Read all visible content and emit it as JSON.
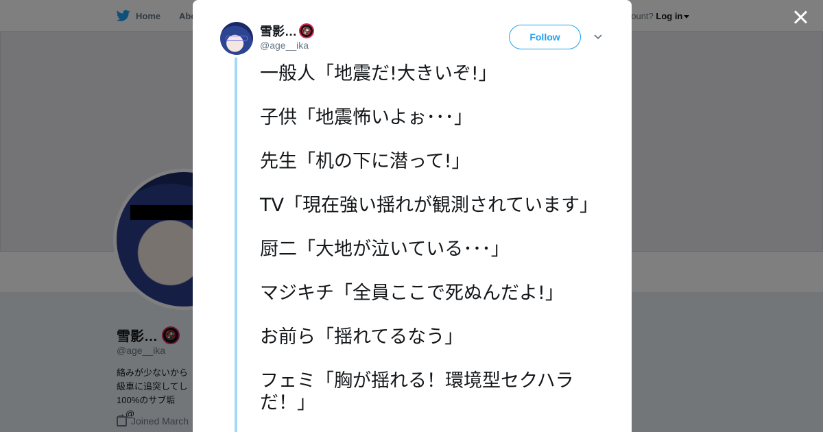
{
  "nav": {
    "home": "Home",
    "about": "Abo",
    "account_prompt": "account?",
    "login": "Log in"
  },
  "profile": {
    "name": "雪影…",
    "handle": "@age__ika",
    "bio": "絡みが少ないから級車に追突してし100%のサブ垢→@",
    "joined": "Joined March"
  },
  "modal": {
    "name": "雪影…",
    "handle": "@age__ika",
    "follow_label": "Follow",
    "badge_glyph": "🚱",
    "tweet_lines": [
      "一般人「地震だ!大きいぞ!」",
      "子供「地震怖いよぉ･･･」",
      "先生「机の下に潜って!」",
      "TV「現在強い揺れが観測されています」",
      "厨二「大地が泣いている･･･」",
      "マジキチ「全員ここで死ぬんだよ!」",
      "お前ら「揺れてるなう」",
      "フェミ「胸が揺れる！環境型セクハラだ！」"
    ]
  },
  "icons": {
    "logo": "twitter-bird-icon",
    "close": "close-icon",
    "more": "chevron-down-icon",
    "calendar": "calendar-icon"
  },
  "colors": {
    "accent": "#1da1f2",
    "thread_line": "#a4d9f5",
    "overlay": "rgba(0,0,0,0.5)"
  }
}
